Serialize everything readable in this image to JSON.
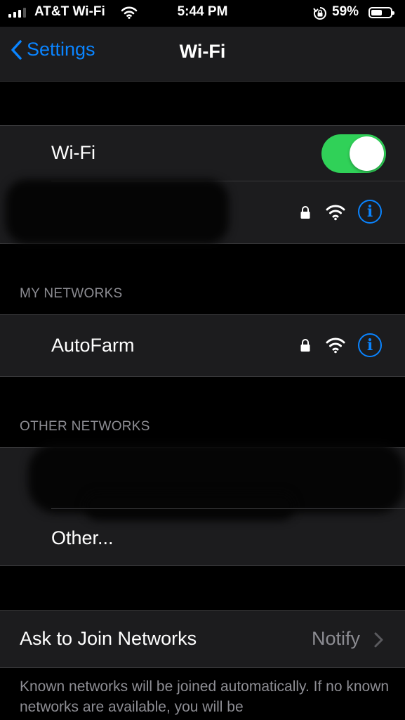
{
  "status_bar": {
    "carrier": "AT&T Wi-Fi",
    "time": "5:44 PM",
    "battery_percent": "59%",
    "battery_level": 0.59,
    "signal_bars": 3
  },
  "nav": {
    "back_label": "Settings",
    "title": "Wi-Fi"
  },
  "wifi_toggle": {
    "label": "Wi-Fi",
    "on": true
  },
  "sections": {
    "my_networks_header": "MY NETWORKS",
    "other_networks_header": "OTHER NETWORKS"
  },
  "my_networks": [
    {
      "name": "AutoFarm",
      "secured": true
    }
  ],
  "other_networks": {
    "other_label": "Other..."
  },
  "ask_to_join": {
    "label": "Ask to Join Networks",
    "value": "Notify"
  },
  "footer": {
    "text": "Known networks will be joined automatically. If no known networks are available, you will be"
  },
  "colors": {
    "accent": "#0a84ff",
    "toggle_on": "#30d158",
    "cell_bg": "#1c1c1e",
    "secondary_text": "#8d8d93"
  }
}
